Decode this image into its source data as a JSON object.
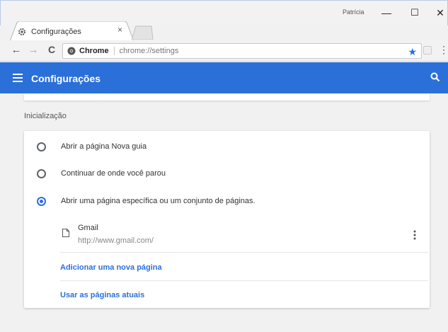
{
  "window": {
    "username": "Patrícia",
    "minimize": "—",
    "maximize": "☐",
    "close": "✕"
  },
  "tab": {
    "title": "Configurações",
    "close": "×"
  },
  "toolbar": {
    "back": "←",
    "forward": "→",
    "reload": "C",
    "chip_label": "Chrome",
    "url": "chrome://settings",
    "menu": "⋮"
  },
  "appbar": {
    "title": "Configurações"
  },
  "section": {
    "title": "Inicialização"
  },
  "options": [
    {
      "label": "Abrir a página Nova guia",
      "checked": false
    },
    {
      "label": "Continuar de onde você parou",
      "checked": false
    },
    {
      "label": "Abrir uma página específica ou um conjunto de páginas.",
      "checked": true
    }
  ],
  "startup_page": {
    "name": "Gmail",
    "url": "http://www.gmail.com/"
  },
  "links": {
    "add_page": "Adicionar uma nova página",
    "use_current": "Usar as páginas atuais"
  },
  "colors": {
    "accent": "#2b70d8"
  }
}
